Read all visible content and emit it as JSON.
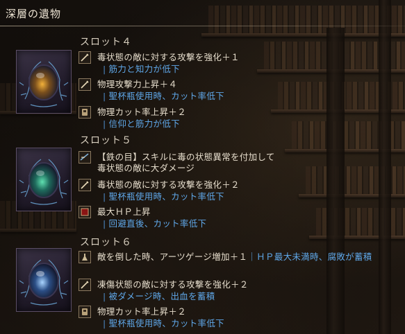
{
  "header": {
    "title": "深層の遺物"
  },
  "slots": [
    {
      "title": "スロット４",
      "relic_icon": "relic-gold-orb",
      "effects": [
        {
          "icon": "sword-icon",
          "text": "毒状態の敵に対する攻撃を強化＋１",
          "sub": "筋力と知力が低下"
        },
        {
          "icon": "sword-icon",
          "text": "物理攻撃力上昇＋４",
          "sub": "聖杯瓶使用時、カット率低下"
        },
        {
          "icon": "armor-icon",
          "text": "物理カット率上昇＋２",
          "sub": "信仰と筋力が低下"
        }
      ]
    },
    {
      "title": "スロット５",
      "relic_icon": "relic-green-orb",
      "effects": [
        {
          "icon": "iron-eye-icon",
          "text": "【鉄の目】スキルに毒の状態異常を付加して",
          "text2": "毒状態の敵に大ダメージ",
          "sub": ""
        },
        {
          "icon": "sword-icon",
          "text": "毒状態の敵に対する攻撃を強化＋２",
          "sub": "聖杯瓶使用時、カット率低下"
        },
        {
          "icon": "hp-icon",
          "text": "最大ＨＰ上昇",
          "sub": "回避直後、カット率低下"
        }
      ]
    },
    {
      "title": "スロット６",
      "relic_icon": "relic-blue-orb",
      "effects": [
        {
          "icon": "flask-icon",
          "text": "敵を倒した時、アーツゲージ増加＋１",
          "inline_sub": "ＨＰ最大未満時、腐敗が蓄積",
          "sub": ""
        },
        {
          "icon": "sword-icon",
          "text": "凍傷状態の敵に対する攻撃を強化＋２",
          "sub": "被ダメージ時、出血を蓄積"
        },
        {
          "icon": "armor-icon",
          "text": "物理カット率上昇＋２",
          "sub": "聖杯瓶使用時、カット率低下"
        }
      ]
    }
  ],
  "colors": {
    "text": "#e6ddcc",
    "sub_text": "#5fa7e8",
    "relic_frame": "#3b3346"
  }
}
